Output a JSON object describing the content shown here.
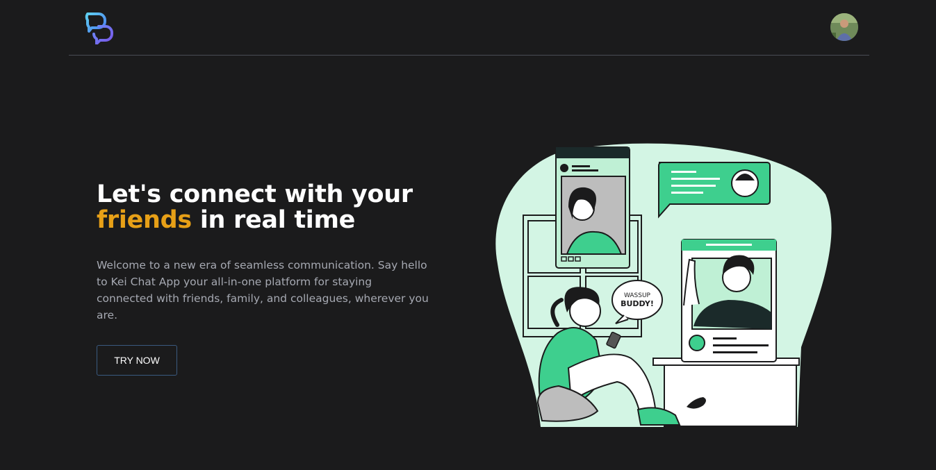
{
  "header": {
    "logo_icon": "chat-bubbles-logo-icon",
    "avatar_icon": "user-avatar"
  },
  "hero": {
    "title_part1": "Let's connect with your",
    "title_highlight": "friends",
    "title_part2": " in real time",
    "description": "Welcome to a new era of seamless communication. Say hello to Kei Chat App your all-in-one platform for staying connected with friends, family, and colleagues, wherever you are.",
    "cta_label": "TRY NOW"
  },
  "illustration": {
    "speech_bubble_line1": "WASSUP",
    "speech_bubble_line2": "BUDDY!"
  },
  "colors": {
    "background": "#1b1b1c",
    "highlight": "#e7a017",
    "mint": "#d3f5e4",
    "green": "#3ecf8e"
  }
}
